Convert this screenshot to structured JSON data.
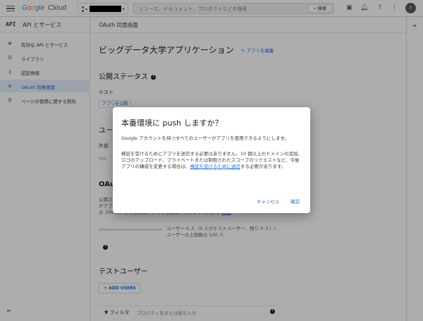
{
  "topbar": {
    "logo": [
      "G",
      "o",
      "o",
      "g",
      "l",
      "e"
    ],
    "logo_suffix": "Cloud",
    "search_placeholder": "リソース、ドキュメント、プロダクトなどを検索",
    "search_button": "検索",
    "avatar_letter": "r"
  },
  "sidebar": {
    "api_badge": "API",
    "title": "API とサービス",
    "items": [
      {
        "label": "有効な API とサービス",
        "icon": "apps-icon"
      },
      {
        "label": "ライブラリ",
        "icon": "library-icon"
      },
      {
        "label": "認証情報",
        "icon": "key-icon"
      },
      {
        "label": "OAuth 同意画面",
        "icon": "consent-icon",
        "active": true
      },
      {
        "label": "ページの使用に関する契約",
        "icon": "agreement-icon"
      }
    ]
  },
  "main": {
    "breadcrumb": "OAuth 同意画面",
    "app_title": "ビッグデータ大学アプリケーション",
    "edit_link": "アプリを編集",
    "publish_status_title": "公開ステータス",
    "status_value": "テスト",
    "publish_button": "アプリを公開",
    "user_type_title": "ユー",
    "user_type_value": "外部",
    "user_type_note": "内部",
    "oauth_title": "OAut",
    "oauth_line1": "公開ス",
    "oauth_line2": "がアプ",
    "oauth_line3": "は 100 に、この上限はアプリの全期間でカウントされます",
    "oauth_link": "詳細",
    "user_count_line1": "ユーザー 0 人（0 人がテストユーザー、残り 0 人）/",
    "user_count_line2": "ユーザーの上限数は 100 人",
    "user_cap_fraction": 0,
    "test_users_title": "テストユーザー",
    "add_users_button": "+ ADD USERS",
    "filter_label": "フィルタ",
    "filter_placeholder": "プロパティ名または値を入力"
  },
  "dialog": {
    "title": "本番環境に push しますか？",
    "para1": "Google アカウントを持つすべてのユーザーがアプリを使用できるようにします。",
    "para2_text": "検証を受けるためにアプリを送信する必要はありません。10 個以上のドメインの追加、ロゴのアップロード、プライベートまたは制限されたスコープのリクエストなど、今後アプリの構成を変更する場合は、",
    "para2_link": "検証を受けるために送信",
    "para2_end": "する必要があります。",
    "cancel": "キャンセル",
    "confirm": "確認"
  }
}
